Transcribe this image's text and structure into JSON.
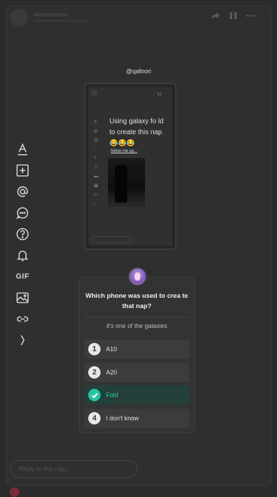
{
  "story": {
    "username": "@qafoori"
  },
  "preview": {
    "caption": "Using galaxy fo ld to create this nap 😂😂😂",
    "follow_text": "follow me up..."
  },
  "toolbar": {
    "gif_label": "GIF",
    "icons": [
      "text-icon",
      "add-icon",
      "mention-icon",
      "chat-icon",
      "question-icon",
      "bell-icon",
      "gif-icon",
      "image-icon",
      "link-icon",
      "chevron-right-icon"
    ]
  },
  "poll": {
    "question": "Which phone was used to crea te that nap?",
    "hint": "it's one of the galaxies",
    "options": [
      {
        "number": "1",
        "label": "A10"
      },
      {
        "number": "2",
        "label": "A20"
      },
      {
        "number": "",
        "label": "Fold",
        "correct": true
      },
      {
        "number": "4",
        "label": "I don't know"
      }
    ],
    "correct_color": "#26c4a0"
  },
  "reply": {
    "placeholder": "Reply to this nap..."
  }
}
